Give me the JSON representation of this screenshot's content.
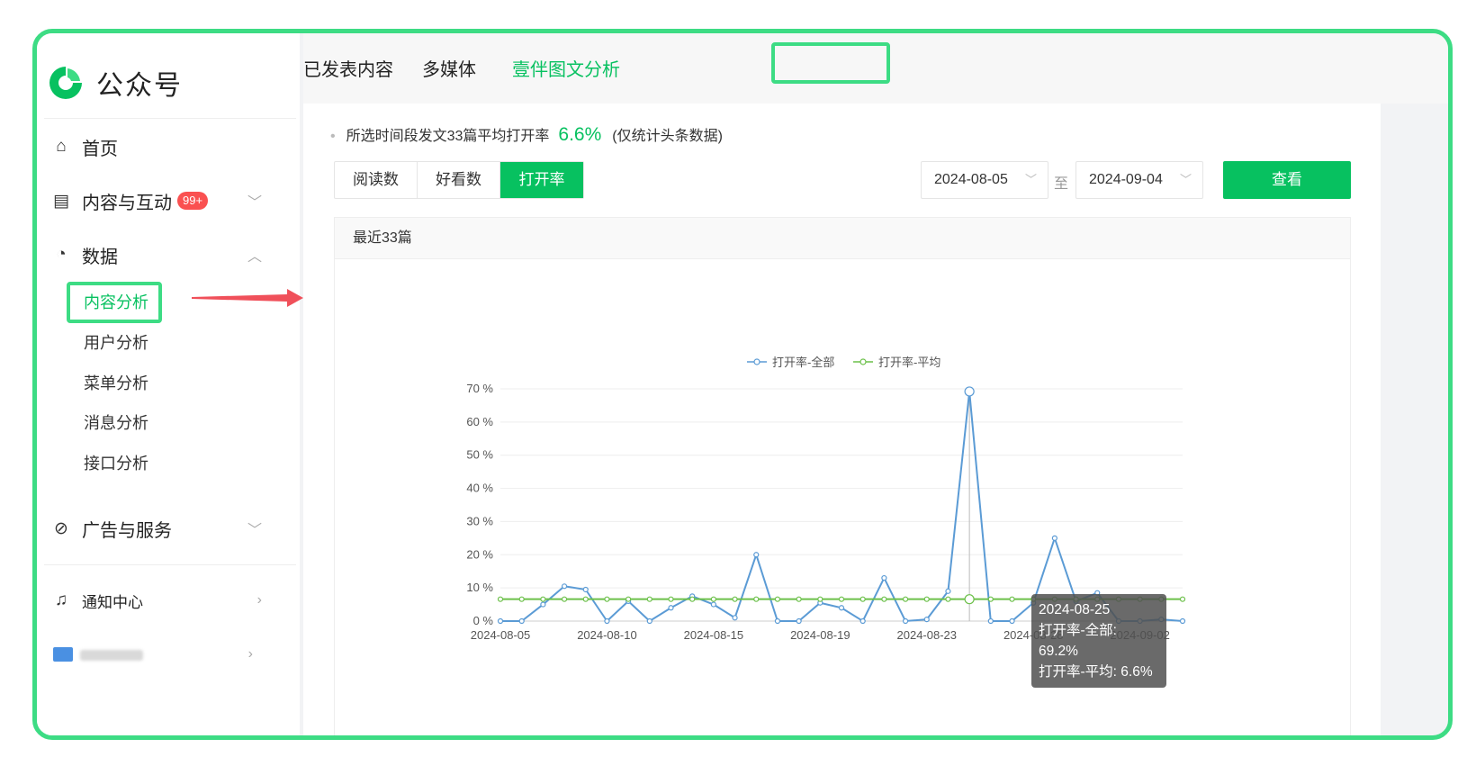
{
  "app": {
    "title": "公众号"
  },
  "sidebar": {
    "items": [
      {
        "label": "首页",
        "icon": "home-icon"
      },
      {
        "label": "内容与互动",
        "icon": "document-icon",
        "badge": "99+"
      },
      {
        "label": "数据",
        "icon": "pie-chart-icon"
      },
      {
        "label": "广告与服务",
        "icon": "compass-icon"
      },
      {
        "label": "通知中心",
        "icon": "bell-icon"
      }
    ],
    "data_sub_items": [
      {
        "label": "内容分析",
        "active": true
      },
      {
        "label": "用户分析"
      },
      {
        "label": "菜单分析"
      },
      {
        "label": "消息分析"
      },
      {
        "label": "接口分析"
      }
    ]
  },
  "tabs": [
    {
      "label": "已发表内容"
    },
    {
      "label": "多媒体"
    },
    {
      "label": "壹伴图文分析",
      "active": true
    }
  ],
  "summary": {
    "prefix": "所选时间段发文33篇平均打开率",
    "value": "6.6%",
    "suffix": "(仅统计头条数据)"
  },
  "metric_tabs": [
    {
      "label": "阅读数"
    },
    {
      "label": "好看数"
    },
    {
      "label": "打开率",
      "active": true
    }
  ],
  "date_range": {
    "start": "2024-08-05",
    "to_label": "至",
    "end": "2024-09-04"
  },
  "query_button": "查看",
  "panel_title": "最近33篇",
  "colors": {
    "accent": "#07c160",
    "series_all": "#5b9bd5",
    "series_avg": "#6cc04a",
    "highlight": "#3ddc84"
  },
  "chart_data": {
    "type": "line",
    "x": [
      "2024-08-05",
      "2024-08-06",
      "2024-08-07",
      "2024-08-08",
      "2024-08-09",
      "2024-08-10",
      "2024-08-11",
      "2024-08-12",
      "2024-08-13",
      "2024-08-14",
      "2024-08-15",
      "2024-08-16",
      "2024-08-17",
      "2024-08-18",
      "2024-08-19",
      "2024-08-20",
      "2024-08-21",
      "2024-08-22",
      "2024-08-23",
      "2024-08-24",
      "2024-08-25",
      "2024-08-26",
      "2024-08-27",
      "2024-08-28",
      "2024-08-29",
      "2024-08-30",
      "2024-08-31",
      "2024-09-01",
      "2024-09-02",
      "2024-09-03",
      "2024-09-04",
      "2024-09-05",
      "2024-09-06"
    ],
    "x_tick_labels": [
      "2024-08-05",
      "2024-08-10",
      "2024-08-15",
      "2024-08-19",
      "2024-08-23",
      "2024-08-28",
      "2024-09-02"
    ],
    "x_tick_indices": [
      0,
      5,
      10,
      15,
      20,
      25,
      30
    ],
    "series": [
      {
        "name": "打开率-全部",
        "values": [
          0,
          0,
          5,
          10.5,
          9.5,
          0,
          6,
          0,
          4,
          7.5,
          5,
          1,
          20,
          0,
          0,
          5.5,
          4,
          0,
          13,
          0,
          0.5,
          9,
          69.2,
          0,
          0,
          5.5,
          25,
          6,
          8.5,
          0,
          0,
          0.5,
          0
        ]
      },
      {
        "name": "打开率-平均",
        "values": [
          6.6,
          6.6,
          6.6,
          6.6,
          6.6,
          6.6,
          6.6,
          6.6,
          6.6,
          6.6,
          6.6,
          6.6,
          6.6,
          6.6,
          6.6,
          6.6,
          6.6,
          6.6,
          6.6,
          6.6,
          6.6,
          6.6,
          6.6,
          6.6,
          6.6,
          6.6,
          6.6,
          6.6,
          6.6,
          6.6,
          6.6,
          6.6,
          6.6
        ]
      }
    ],
    "y_ticks": [
      "0 %",
      "10 %",
      "20 %",
      "30 %",
      "40 %",
      "50 %",
      "60 %",
      "70 %"
    ],
    "ylim": [
      0,
      70
    ],
    "legend_position": "top-center",
    "highlight_index": 22
  },
  "tooltip": {
    "date": "2024-08-25",
    "line1": "打开率-全部: 69.2%",
    "line2": "打开率-平均: 6.6%"
  }
}
